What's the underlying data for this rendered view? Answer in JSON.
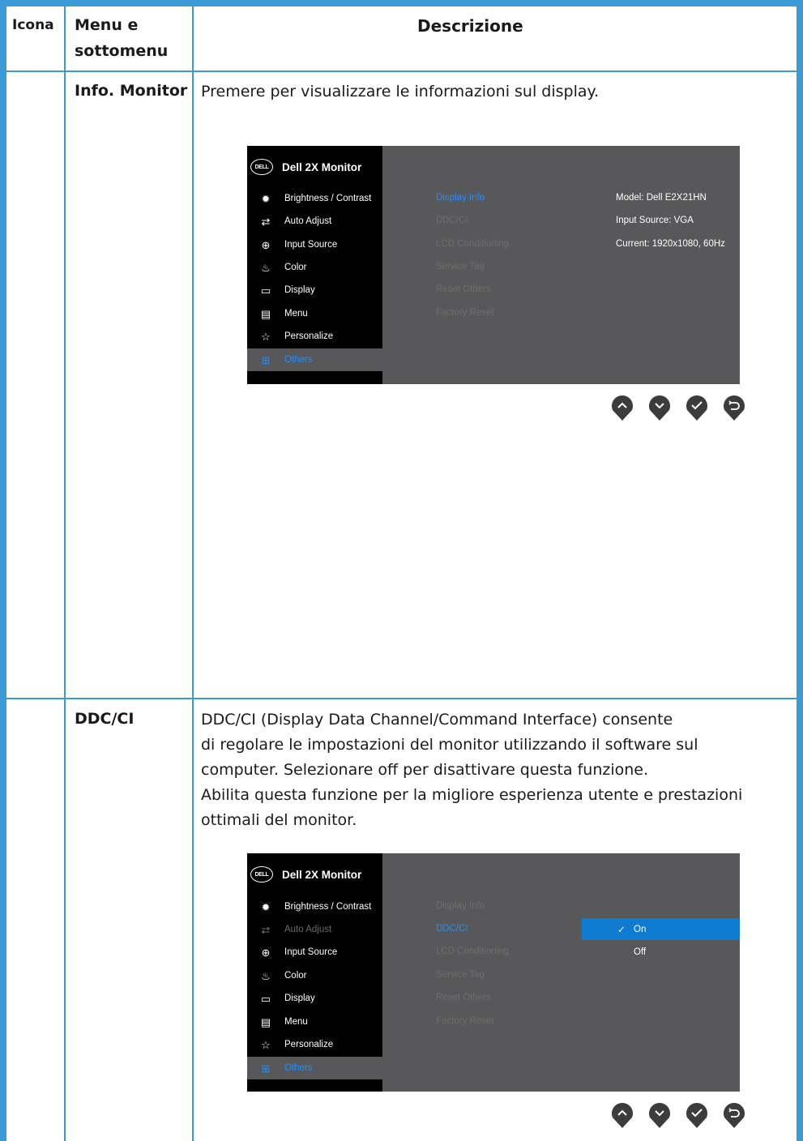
{
  "header": {
    "col_icon": "Icona",
    "col_menu_line1": "Menu e",
    "col_menu_line2": "sottomenu",
    "col_desc": "Descrizione"
  },
  "rows": [
    {
      "menu": "Info. Monitor",
      "description": [
        "Premere per visualizzare le informazioni sul display."
      ]
    },
    {
      "menu": "DDC/CI",
      "description": [
        "DDC/CI (Display Data Channel/Command Interface) consente",
        "di regolare le impostazioni del monitor utilizzando il software sul",
        "computer. Selezionare off per disattivare questa funzione.",
        "Abilita questa funzione per la migliore esperienza utente e prestazioni",
        "ottimali del monitor."
      ]
    }
  ],
  "osd": {
    "logo": "DELL",
    "title": "Dell 2X Monitor",
    "menu": [
      {
        "label": "Brightness / Contrast",
        "icon": "sun-icon"
      },
      {
        "label": "Auto Adjust",
        "icon": "auto-adjust-icon"
      },
      {
        "label": "Input Source",
        "icon": "input-source-icon"
      },
      {
        "label": "Color",
        "icon": "color-icon"
      },
      {
        "label": "Display",
        "icon": "display-icon"
      },
      {
        "label": "Menu",
        "icon": "menu-icon"
      },
      {
        "label": "Personalize",
        "icon": "star-icon"
      },
      {
        "label": "Others",
        "icon": "others-icon"
      }
    ],
    "submenu": [
      "Display Info",
      "DDC/CI",
      "LCD Conditioning",
      "Service Tag",
      "Reset Others",
      "Factory Reset"
    ],
    "info_lines": [
      "Model: Dell E2X21HN",
      "Input Source: VGA",
      "Current: 1920x1080, 60Hz"
    ],
    "ddc_options": [
      "On",
      "Off"
    ],
    "buttons": [
      "up-icon",
      "down-icon",
      "check-icon",
      "back-icon"
    ],
    "colors": {
      "highlight": "#1e90ff",
      "selected_bar": "#0f7bd1",
      "panel": "#58585a",
      "border": "#3d9ad8"
    }
  }
}
